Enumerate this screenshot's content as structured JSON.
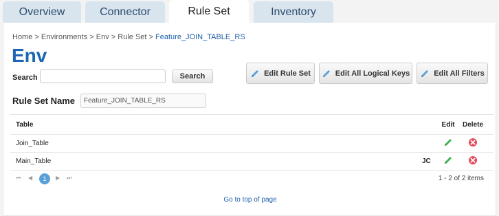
{
  "tabs": [
    {
      "label": "Overview"
    },
    {
      "label": "Connector"
    },
    {
      "label": "Rule Set"
    },
    {
      "label": "Inventory"
    }
  ],
  "breadcrumb": {
    "items": [
      "Home",
      "Environments",
      "Env",
      "Rule Set"
    ],
    "separator": ">",
    "current": "Feature_JOIN_TABLE_RS"
  },
  "page_title": "Env",
  "search": {
    "label": "Search",
    "value": "",
    "placeholder": "",
    "button": "Search"
  },
  "actions": {
    "edit_rule_set": "Edit Rule Set",
    "edit_logical_keys": "Edit All Logical Keys",
    "edit_filters": "Edit All Filters"
  },
  "rule_set_name": {
    "label": "Rule Set Name",
    "value": "Feature_JOIN_TABLE_RS"
  },
  "table": {
    "columns": {
      "table": "Table",
      "edit": "Edit",
      "delete": "Delete"
    },
    "rows": [
      {
        "table": "Join_Table",
        "owner": ""
      },
      {
        "table": "Main_Table",
        "owner": "JC"
      }
    ]
  },
  "pagination": {
    "current_page": "1",
    "info": "1 - 2 of 2 items"
  },
  "footer": {
    "go_top": "Go to top of page"
  },
  "colors": {
    "accent": "#1d66b4",
    "tab_bg": "#d8e4ee",
    "edit_green": "#3bb54a",
    "delete_red": "#e54b5b"
  }
}
